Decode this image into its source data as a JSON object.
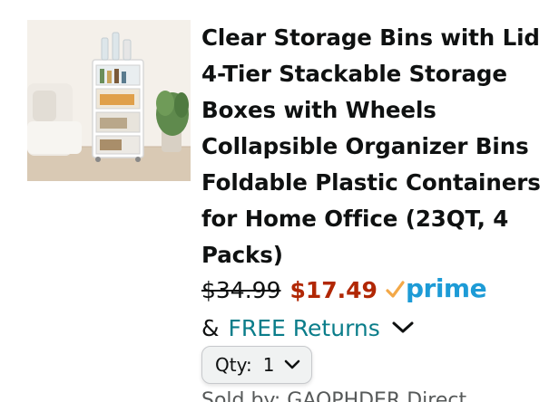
{
  "product": {
    "title_lines": [
      "Clear Storage Bins with Lid",
      "4-Tier Stackable Storage",
      "Boxes with Wheels",
      "Collapsible Organizer Bins",
      "Foldable Plastic Containers",
      "for Home Office (23QT, 4",
      "Packs)"
    ],
    "thumbnail_icon": "product-photo-storage-cart"
  },
  "pricing": {
    "list_price": "$34.99",
    "sale_price": "$17.49",
    "prime_label": "prime",
    "sale_color": "#b12704",
    "prime_color": "#1d9bd6"
  },
  "returns": {
    "prefix": "&",
    "label": "FREE Returns",
    "link_color": "#0a7d8a"
  },
  "quantity": {
    "label": "Qty:",
    "value": "1"
  },
  "seller": {
    "text": "Sold by: GAOPHDER Direct"
  }
}
